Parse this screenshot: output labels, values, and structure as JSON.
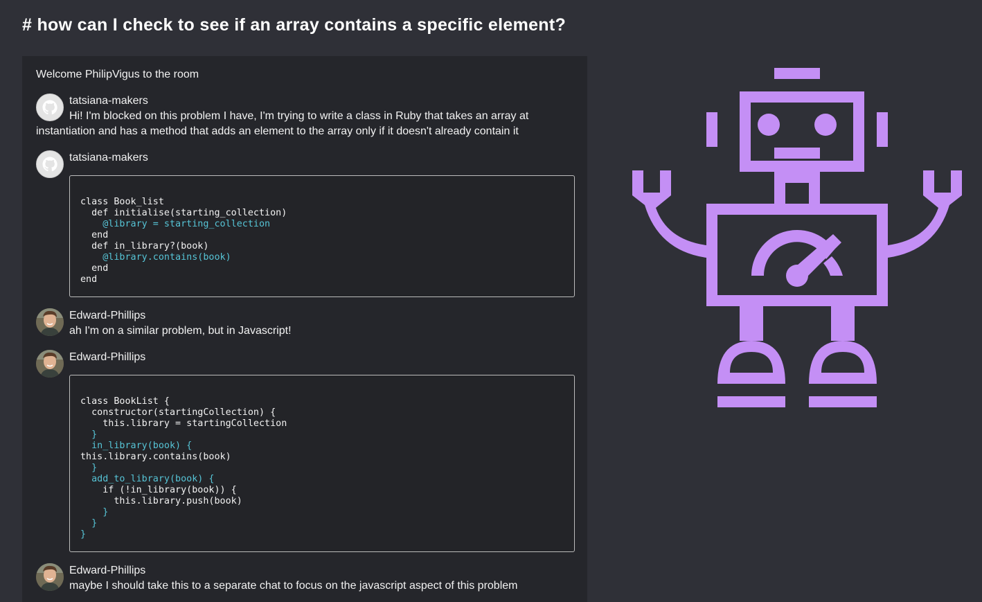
{
  "room": {
    "title": "# how can I check to see if an array contains a specific element?"
  },
  "chat": {
    "welcome": "Welcome PhilipVigus to the room",
    "messages": [
      {
        "author": "tatsiana-makers",
        "avatar": "github-icon",
        "text": "Hi! I'm blocked on this problem I have, I'm trying to write a class in Ruby that takes an array at instantiation and has a method that adds an element to the array only if it doesn't already contain it"
      },
      {
        "author": "tatsiana-makers",
        "avatar": "github-icon",
        "code": [
          "class Book_list",
          "  def initialise(starting_collection)",
          "    @library = starting_collection",
          "  end",
          "  def in_library?(book)",
          "    @library.contains(book)",
          "  end",
          "end"
        ]
      },
      {
        "author": "Edward-Phillips",
        "avatar": "user-photo",
        "text": "ah I'm on a similar problem, but in Javascript!"
      },
      {
        "author": "Edward-Phillips",
        "avatar": "user-photo",
        "code": [
          "class BookList {",
          "  constructor(startingCollection) {",
          "    this.library = startingCollection",
          "  }",
          "  in_library(book) {",
          "this.library.contains(book)",
          "  }",
          "  add_to_library(book) {",
          "    if (!in_library(book)) {",
          "      this.library.push(book)",
          "    }",
          "  }",
          "}"
        ]
      },
      {
        "author": "Edward-Phillips",
        "avatar": "user-photo",
        "text": "maybe I should take this to a separate chat to focus on the javascript aspect of this problem"
      }
    ]
  },
  "colors": {
    "background": "#2f3037",
    "panel": "#25262b",
    "code_accent": "#56c4d6",
    "robot": "#c48ff5"
  },
  "illustration": {
    "icon": "robot-icon"
  }
}
